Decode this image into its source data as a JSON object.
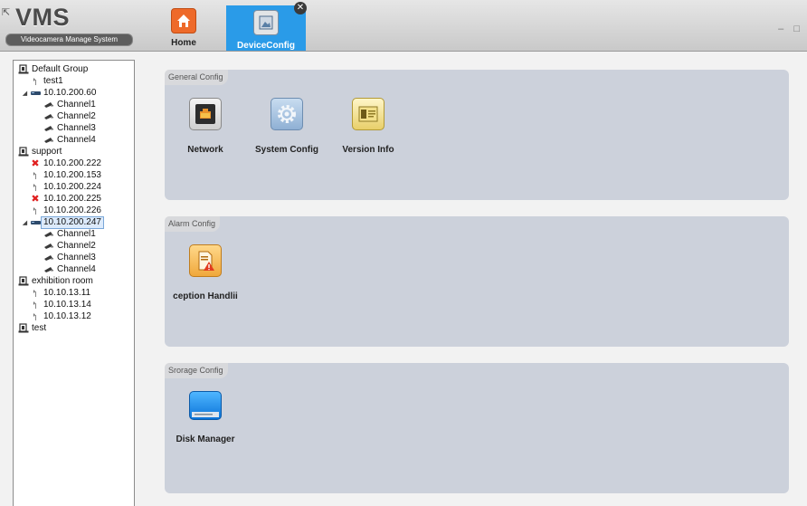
{
  "app": {
    "logo_title": "VMS",
    "logo_subtitle": "Videocamera Manage System",
    "window_controls": "– □"
  },
  "tabs": [
    {
      "label": "Home",
      "icon": "home-icon"
    },
    {
      "label": "DeviceConfig",
      "icon": "device-config-icon",
      "close_glyph": "✕"
    }
  ],
  "tree": [
    {
      "label": "Default Group",
      "level": 0,
      "type": "group"
    },
    {
      "label": "test1",
      "level": 1,
      "type": "device"
    },
    {
      "label": "10.10.200.60",
      "level": 1,
      "type": "dvr",
      "expanded": true
    },
    {
      "label": "Channel1",
      "level": 2,
      "type": "channel"
    },
    {
      "label": "Channel2",
      "level": 2,
      "type": "channel"
    },
    {
      "label": "Channel3",
      "level": 2,
      "type": "channel"
    },
    {
      "label": "Channel4",
      "level": 2,
      "type": "channel"
    },
    {
      "label": "support",
      "level": 0,
      "type": "group"
    },
    {
      "label": "10.10.200.222",
      "level": 1,
      "type": "offline"
    },
    {
      "label": "10.10.200.153",
      "level": 1,
      "type": "device"
    },
    {
      "label": "10.10.200.224",
      "level": 1,
      "type": "device"
    },
    {
      "label": "10.10.200.225",
      "level": 1,
      "type": "offline"
    },
    {
      "label": "10.10.200.226",
      "level": 1,
      "type": "device"
    },
    {
      "label": "10.10.200.247",
      "level": 1,
      "type": "dvr",
      "expanded": true,
      "selected": true
    },
    {
      "label": "Channel1",
      "level": 2,
      "type": "channel"
    },
    {
      "label": "Channel2",
      "level": 2,
      "type": "channel"
    },
    {
      "label": "Channel3",
      "level": 2,
      "type": "channel"
    },
    {
      "label": "Channel4",
      "level": 2,
      "type": "channel"
    },
    {
      "label": "exhibition room",
      "level": 0,
      "type": "group"
    },
    {
      "label": "10.10.13.11",
      "level": 1,
      "type": "device"
    },
    {
      "label": "10.10.13.14",
      "level": 1,
      "type": "device"
    },
    {
      "label": "10.10.13.12",
      "level": 1,
      "type": "device"
    },
    {
      "label": "test",
      "level": 0,
      "type": "group"
    }
  ],
  "panels": [
    {
      "title": "General Config",
      "items": [
        {
          "label": "Network",
          "icon": "network-port-icon"
        },
        {
          "label": "System Config",
          "icon": "gear-icon"
        },
        {
          "label": "Version Info",
          "icon": "version-info-icon"
        }
      ]
    },
    {
      "title": "Alarm Config",
      "items": [
        {
          "label": "ception Handlii",
          "icon": "exception-alert-icon"
        }
      ]
    },
    {
      "title": "Srorage Config",
      "items": [
        {
          "label": "Disk Manager",
          "icon": "disk-icon"
        }
      ]
    }
  ],
  "colors": {
    "tab_active": "#2a9be8",
    "panel_bg": "#ccd1db",
    "offline_x": "#e02020"
  }
}
